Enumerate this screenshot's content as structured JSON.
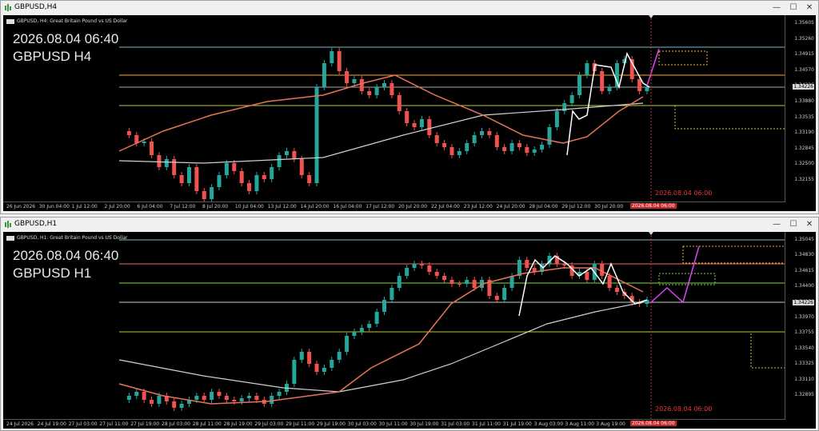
{
  "windows": [
    {
      "id": "h4",
      "title": "GBPUSD,H4",
      "info_line": "GBPUSD, H4:  Great Britain Pound vs US Dollar",
      "overlay_datetime": "2026.08.04 06:40",
      "overlay_symbol": "GBPUSD H4",
      "price_labels": [
        "1.35605",
        "1.35260",
        "1.34915",
        "1.34570",
        "1.34226",
        "1.33880",
        "1.33535",
        "1.33190",
        "1.32845",
        "1.32500",
        "1.32155"
      ],
      "current_price_label": "1.34226",
      "time_labels": [
        "26 Jun 2026",
        "30 Jun 04:00",
        "1 Jul 12:00",
        "2 Jul 20:00",
        "6 Jul 04:00",
        "7 Jul 12:00",
        "8 Jul 20:00",
        "10 Jul 04:00",
        "13 Jul 12:00",
        "14 Jul 20:00",
        "16 Jul 04:00",
        "17 Jul 12:00",
        "20 Jul 20:00",
        "22 Jul 04:00",
        "23 Jul 12:00",
        "24 Jul 20:00",
        "28 Jul 04:00",
        "29 Jul 12:00",
        "30 Jul 20:00"
      ],
      "current_time_label": "2026.08.04 06:00",
      "vline_label": "2026.08.04 06:00"
    },
    {
      "id": "h1",
      "title": "GBPUSD,H1",
      "info_line": "GBPUSD, H1:  Great Britain Pound vs US Dollar",
      "overlay_datetime": "2026.08.04 06:40",
      "overlay_symbol": "GBPUSD H1",
      "price_labels": [
        "1.35045",
        "1.34830",
        "1.34615",
        "1.34400",
        "1.34185",
        "1.33970",
        "1.33755",
        "1.33540",
        "1.33325",
        "1.33110",
        "1.32895"
      ],
      "current_price_label": "1.34226",
      "time_labels": [
        "24 Jul 2026",
        "24 Jul 19:00",
        "27 Jul 03:00",
        "27 Jul 11:00",
        "27 Jul 19:00",
        "28 Jul 03:00",
        "28 Jul 11:00",
        "28 Jul 19:00",
        "29 Jul 03:00",
        "29 Jul 11:00",
        "29 Jul 19:00",
        "30 Jul 03:00",
        "30 Jul 11:00",
        "30 Jul 19:00",
        "31 Jul 03:00",
        "31 Jul 11:00",
        "31 Jul 19:00",
        "3 Aug 03:00",
        "3 Aug 11:00",
        "3 Aug 19:00"
      ],
      "current_time_label": "2026.08.04 06:00",
      "vline_label": "2026.08.04 06:00"
    }
  ],
  "window_controls": {
    "minimize": "—",
    "maximize": "☐",
    "close": "✕"
  },
  "colors": {
    "bull": "#26a69a",
    "bear": "#ef5350",
    "ma_fast": "#e8735a",
    "ma_slow": "#d0d0d0",
    "zigzag": "#ffffff",
    "projection": "#e040fb",
    "vline": "#c62828",
    "hl_orange": "#ffa726",
    "hl_yellow": "#c0ca33",
    "hl_green": "#7cdc3c"
  },
  "icons": [
    "chart-window-icon",
    "symbol-flag-icon",
    "minimize-icon",
    "maximize-icon",
    "close-icon"
  ]
}
